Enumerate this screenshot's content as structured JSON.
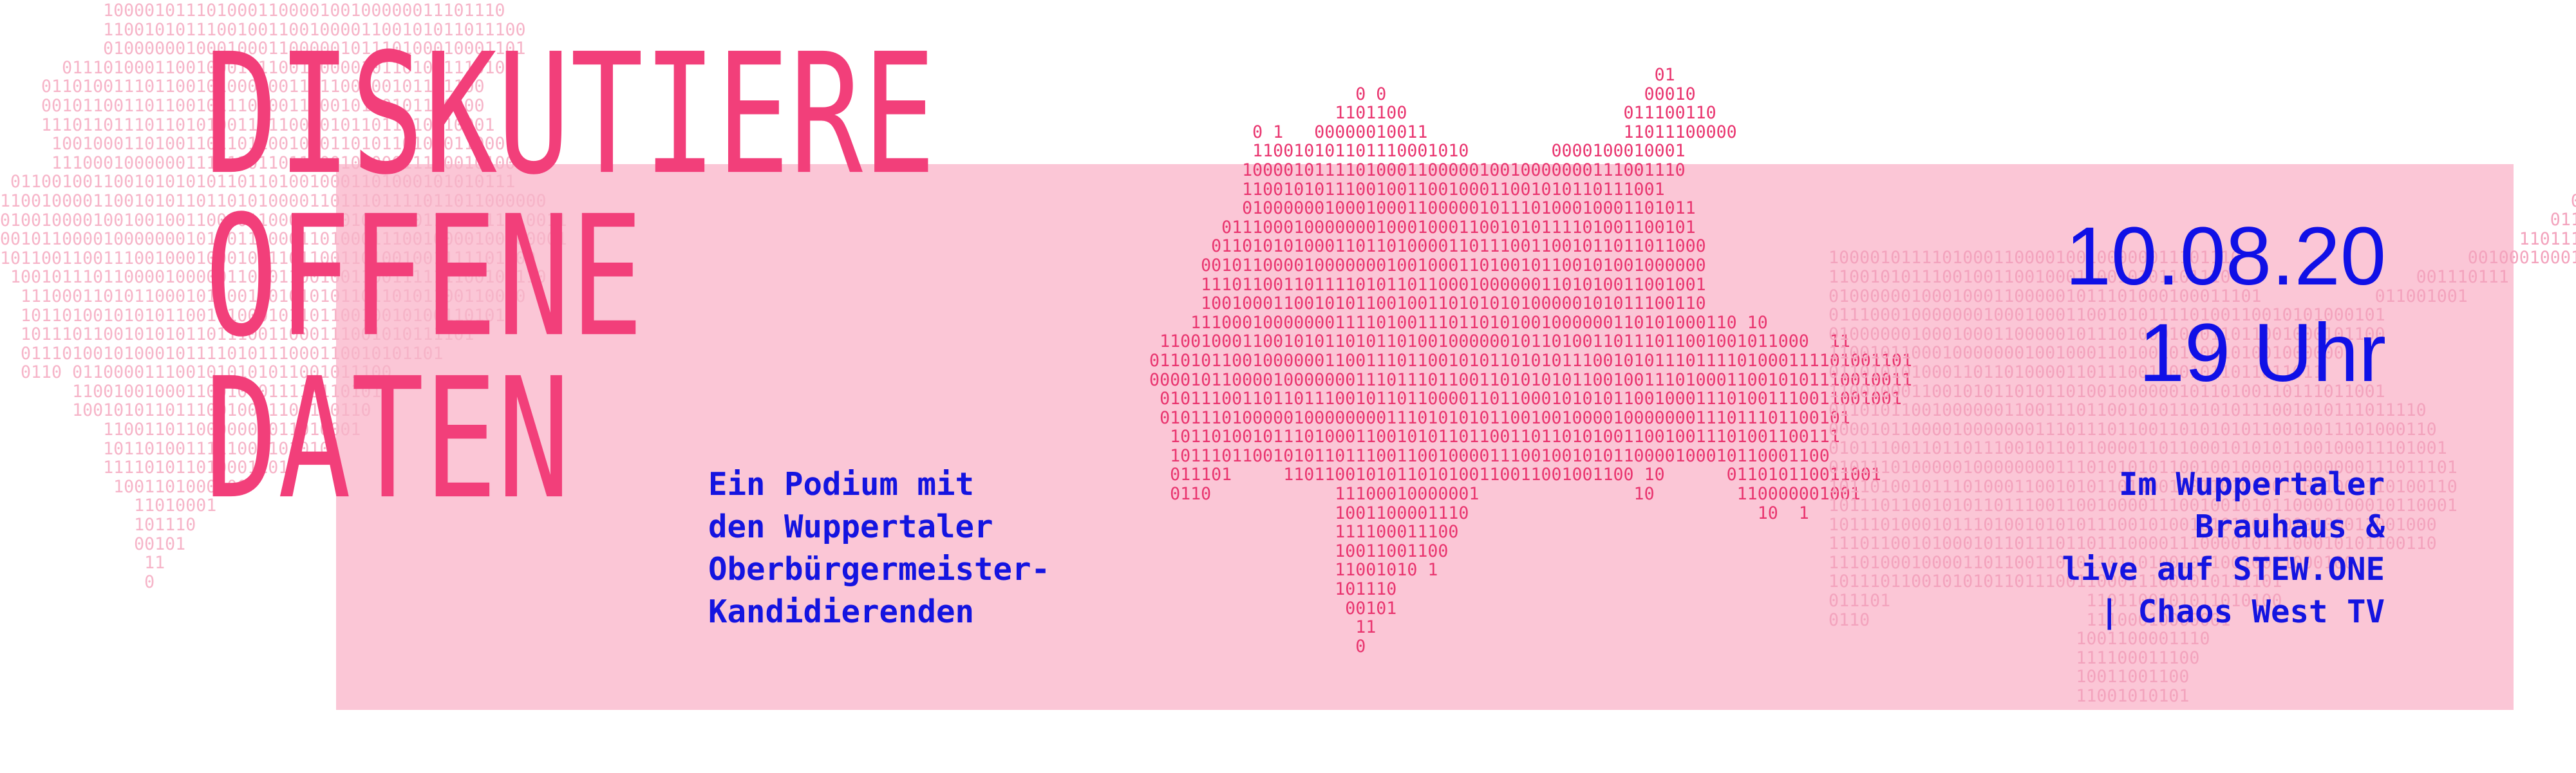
{
  "headline": {
    "line1": "DISKUTIERE",
    "line2": "OFFENE",
    "line3": "DATEN"
  },
  "subtitle": {
    "line1": "Ein Podium mit",
    "line2": "den Wuppertaler",
    "line3": "Oberbürgermeister-",
    "line4": "Kandidierenden"
  },
  "date": {
    "day": "10.08.20",
    "time": "19 Uhr"
  },
  "venue": {
    "line1": "Im Wuppertaler",
    "line2": "Brauhaus &",
    "line3": "live auf STEW.ONE",
    "line4": "| Chaos West TV"
  },
  "colors": {
    "headline": "#f23f7a",
    "band": "#fbc6d6",
    "blue_text": "#1414e0",
    "binary_dark": "#e9356f",
    "binary_light": "#f6b4c8"
  }
}
